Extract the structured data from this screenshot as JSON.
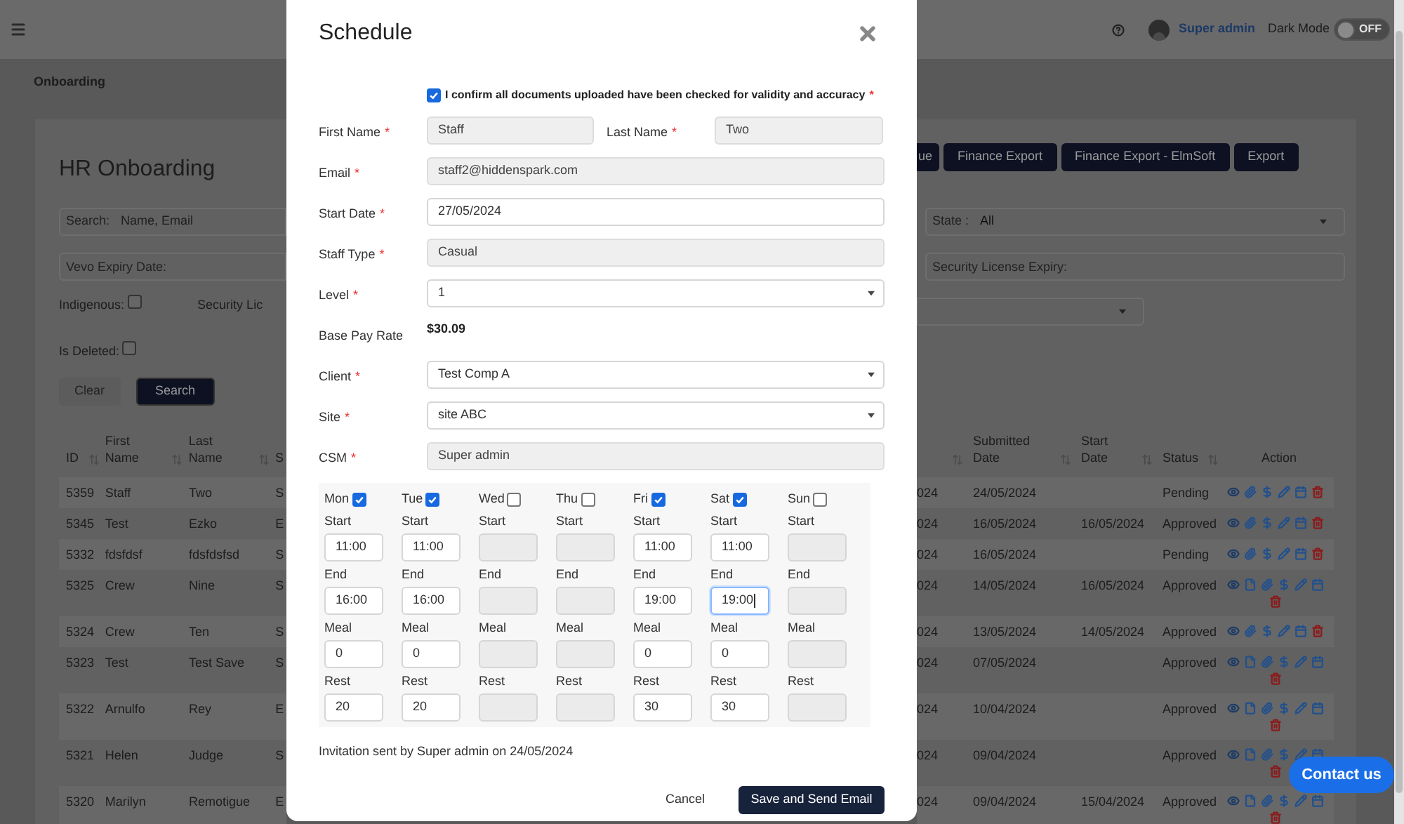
{
  "topbar": {
    "user": "Super admin",
    "dark_mode_label": "Dark Mode",
    "dark_mode": {
      "on": false,
      "label": "OFF"
    }
  },
  "breadcrumb": "Onboarding",
  "title": "HR Onboarding",
  "toolbar_buttons": [
    "ue",
    "Finance Export",
    "Finance Export - ElmSoft",
    "Export"
  ],
  "filters": {
    "search": {
      "label": "Search:",
      "placeholder": "Name, Email"
    },
    "vevo": {
      "placeholder": "Vevo Expiry Date:"
    },
    "state": {
      "label": "State :",
      "value": "All"
    },
    "security_expiry": {
      "placeholder": "Security License Expiry:"
    },
    "indigenous": {
      "label": "Indigenous:",
      "checked": false
    },
    "security_license_label": "Security Lic",
    "is_deleted": {
      "label": "Is Deleted:",
      "checked": false
    }
  },
  "filter_buttons": [
    {
      "label": "Clear",
      "kind": "secondary"
    },
    {
      "label": "Search",
      "kind": "primary"
    }
  ],
  "table": {
    "columns": [
      {
        "label": "ID",
        "sortable": true
      },
      {
        "label": "First Name",
        "sortable": true
      },
      {
        "label": "Last Name",
        "sortable": true
      },
      {
        "label": "S",
        "sortable": false
      },
      {
        "sortable": true
      },
      {
        "label": "Submitted Date",
        "sortable": true
      },
      {
        "label": "Start Date",
        "sortable": true
      },
      {
        "label": "Status",
        "sortable": true
      },
      {
        "label": "Action",
        "sortable": false
      }
    ],
    "rows": [
      {
        "id": "5359",
        "first_name": "Staff",
        "last_name": "Two",
        "column_4": "S",
        "column_5": "024",
        "submitted_date": "24/05/2024",
        "status": "Pending",
        "has_document": false
      },
      {
        "id": "5345",
        "first_name": "Test",
        "last_name": "Ezko",
        "column_4": "E",
        "column_5": "024",
        "submitted_date": "16/05/2024",
        "start_date": "16/05/2024",
        "status": "Approved",
        "has_document": false
      },
      {
        "id": "5332",
        "first_name": "fdsfdsf",
        "last_name": "fdsfdsfsd",
        "column_4": "S",
        "column_5": "024",
        "submitted_date": "16/05/2024",
        "status": "Pending",
        "has_document": false
      },
      {
        "id": "5325",
        "first_name": "Crew",
        "last_name": "Nine",
        "column_4": "S",
        "column_5": "024",
        "submitted_date": "14/05/2024",
        "start_date": "16/05/2024",
        "status": "Approved",
        "has_document": true
      },
      {
        "id": "5324",
        "first_name": "Crew",
        "last_name": "Ten",
        "column_4": "S",
        "column_5": "024",
        "submitted_date": "13/05/2024",
        "start_date": "14/05/2024",
        "status": "Approved",
        "has_document": false
      },
      {
        "id": "5323",
        "first_name": "Test",
        "last_name": "Test Save",
        "column_4": "S",
        "column_5": "024",
        "submitted_date": "07/05/2024",
        "status": "Approved",
        "has_document": true
      },
      {
        "id": "5322",
        "first_name": "Arnulfo",
        "last_name": "Rey",
        "column_4": "E",
        "column_5": "024",
        "submitted_date": "10/04/2024",
        "status": "Approved",
        "has_document": true
      },
      {
        "id": "5321",
        "first_name": "Helen",
        "last_name": "Judge",
        "column_4": "S",
        "column_5": "024",
        "submitted_date": "09/04/2024",
        "status": "Approved",
        "has_document": true
      },
      {
        "id": "5320",
        "first_name": "Marilyn",
        "last_name": "Remotigue",
        "column_4": "E",
        "column_5": "024",
        "submitted_date": "09/04/2024",
        "start_date": "15/04/2024",
        "status": "Approved",
        "has_document": true
      }
    ]
  },
  "modal": {
    "title": "Schedule",
    "confirm": {
      "label": "I confirm all documents uploaded have been checked for validity and accuracy",
      "required_mark": "*",
      "checked": true
    },
    "fields": [
      {
        "kind": "pair",
        "items": [
          {
            "label": "First Name",
            "required_mark": "*",
            "value": "Staff"
          },
          {
            "label": "Last Name",
            "required_mark": "*",
            "value": "Two"
          }
        ]
      },
      {
        "kind": "readonly",
        "label": "Email",
        "required_mark": "*",
        "value": "staff2@hiddenspark.com"
      },
      {
        "kind": "input",
        "label": "Start Date",
        "required_mark": "*",
        "value": "27/05/2024"
      },
      {
        "kind": "readonly",
        "label": "Staff Type",
        "required_mark": "*",
        "value": "Casual"
      },
      {
        "kind": "select",
        "label": "Level",
        "required_mark": "*",
        "value": "1"
      },
      {
        "kind": "text",
        "label": "Base Pay Rate",
        "value": "$30.09"
      },
      {
        "kind": "select",
        "label": "Client",
        "required_mark": "*",
        "value": "Test Comp A"
      },
      {
        "kind": "select",
        "label": "Site",
        "required_mark": "*",
        "value": "site ABC"
      },
      {
        "kind": "readonly",
        "label": "CSM",
        "required_mark": "*",
        "value": "Super admin"
      }
    ],
    "schedule": [
      {
        "day": "Mon",
        "checked": true,
        "fields": [
          {
            "label": "Start",
            "value": "11:00",
            "focused": false
          },
          {
            "label": "End",
            "value": "16:00",
            "focused": false
          },
          {
            "label": "Meal",
            "value": "0",
            "focused": false
          },
          {
            "label": "Rest",
            "value": "20",
            "focused": false
          }
        ]
      },
      {
        "day": "Tue",
        "checked": true,
        "fields": [
          {
            "label": "Start",
            "value": "11:00",
            "focused": false
          },
          {
            "label": "End",
            "value": "16:00",
            "focused": false
          },
          {
            "label": "Meal",
            "value": "0",
            "focused": false
          },
          {
            "label": "Rest",
            "value": "20",
            "focused": false
          }
        ]
      },
      {
        "day": "Wed",
        "checked": false,
        "fields": [
          {
            "label": "Start",
            "focused": false
          },
          {
            "label": "End",
            "focused": false
          },
          {
            "label": "Meal",
            "focused": false
          },
          {
            "label": "Rest",
            "focused": false
          }
        ]
      },
      {
        "day": "Thu",
        "checked": false,
        "fields": [
          {
            "label": "Start",
            "focused": false
          },
          {
            "label": "End",
            "focused": false
          },
          {
            "label": "Meal",
            "focused": false
          },
          {
            "label": "Rest",
            "focused": false
          }
        ]
      },
      {
        "day": "Fri",
        "checked": true,
        "fields": [
          {
            "label": "Start",
            "value": "11:00",
            "focused": false
          },
          {
            "label": "End",
            "value": "19:00",
            "focused": false
          },
          {
            "label": "Meal",
            "value": "0",
            "focused": false
          },
          {
            "label": "Rest",
            "value": "30",
            "focused": false
          }
        ]
      },
      {
        "day": "Sat",
        "checked": true,
        "fields": [
          {
            "label": "Start",
            "value": "11:00",
            "focused": false
          },
          {
            "label": "End",
            "value": "19:00",
            "focused": true
          },
          {
            "label": "Meal",
            "value": "0",
            "focused": false
          },
          {
            "label": "Rest",
            "value": "30",
            "focused": false
          }
        ]
      },
      {
        "day": "Sun",
        "checked": false,
        "fields": [
          {
            "label": "Start",
            "focused": false
          },
          {
            "label": "End",
            "focused": false
          },
          {
            "label": "Meal",
            "focused": false
          },
          {
            "label": "Rest",
            "focused": false
          }
        ]
      }
    ],
    "note": "Invitation sent by Super admin on 24/05/2024",
    "buttons": [
      {
        "label": "Cancel",
        "kind": "link"
      },
      {
        "label": "Save and Send Email",
        "kind": "primary"
      }
    ]
  },
  "contact_button": "Contact us"
}
